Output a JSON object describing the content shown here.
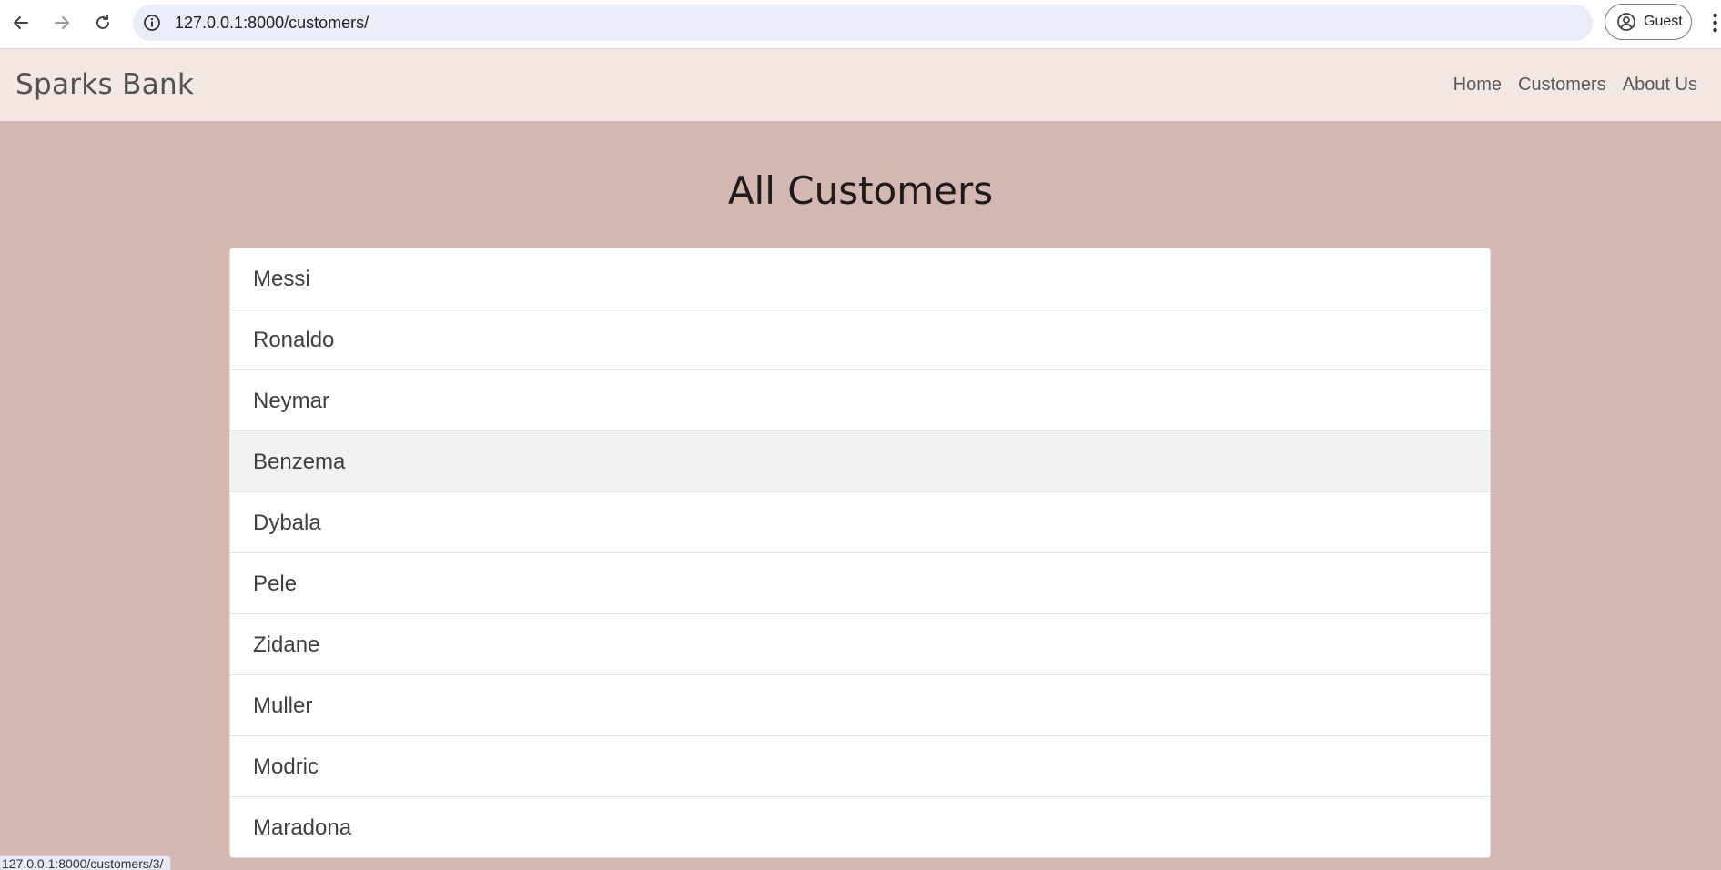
{
  "browser": {
    "url": "127.0.0.1:8000/customers/",
    "profile_label": "Guest"
  },
  "navbar": {
    "brand": "Sparks Bank",
    "links": [
      "Home",
      "Customers",
      "About Us"
    ]
  },
  "main": {
    "title": "All Customers",
    "customers": [
      "Messi",
      "Ronaldo",
      "Neymar",
      "Benzema",
      "Dybala",
      "Pele",
      "Zidane",
      "Muller",
      "Modric",
      "Maradona"
    ],
    "hovered_customer": "Benzema"
  },
  "status_bar": {
    "text": "127.0.0.1:8000/customers/3/"
  }
}
